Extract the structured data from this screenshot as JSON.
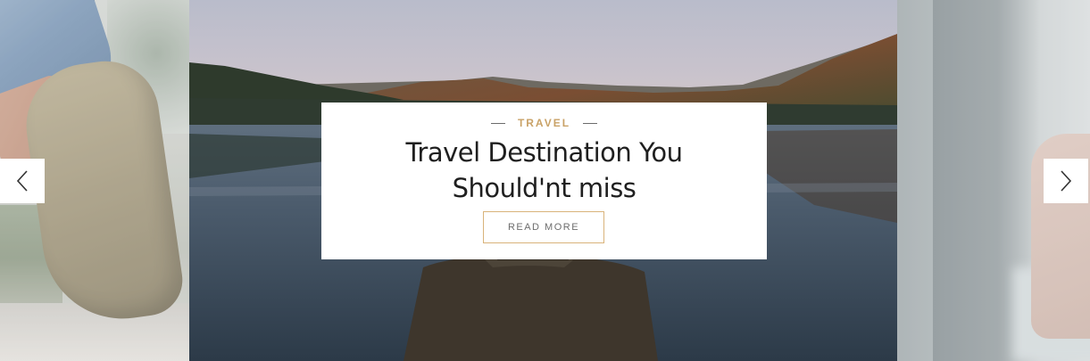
{
  "slider": {
    "prev_icon": "chevron-left-icon",
    "next_icon": "chevron-right-icon"
  },
  "slide": {
    "category": "TRAVEL",
    "title": "Travel Destination You Should'nt miss",
    "read_more_label": "READ MORE"
  },
  "colors": {
    "accent": "#c9a267",
    "button_border": "#d9b37a",
    "title_text": "#1f1f1f",
    "button_text": "#6e6e6e"
  }
}
